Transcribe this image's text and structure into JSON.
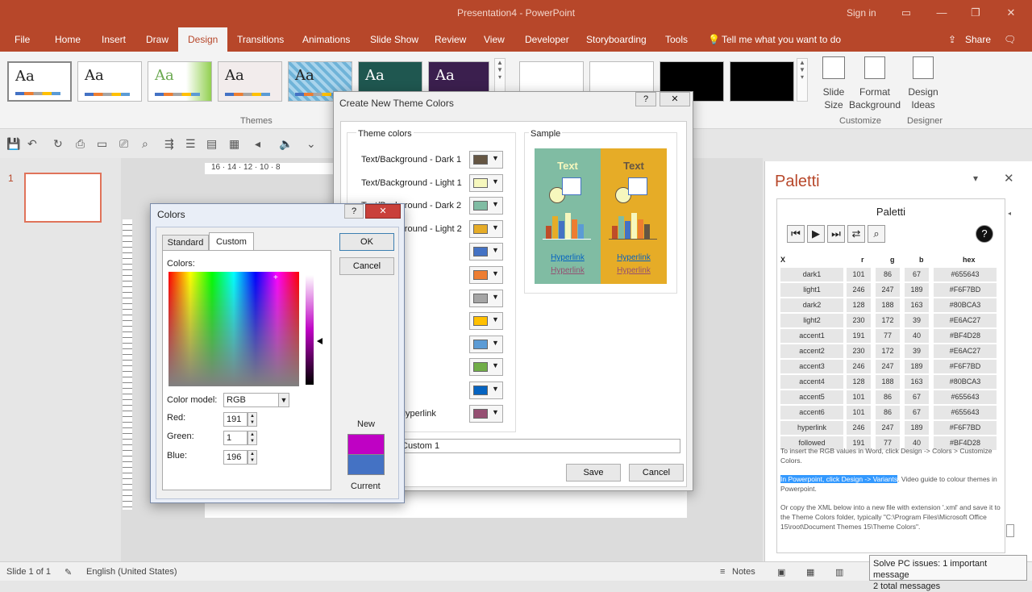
{
  "app": {
    "title": "Presentation4 - PowerPoint",
    "sign_in": "Sign in"
  },
  "tabs": [
    "File",
    "Home",
    "Insert",
    "Draw",
    "Design",
    "Transitions",
    "Animations",
    "Slide Show",
    "Review",
    "View",
    "Developer",
    "Storyboarding",
    "Tools"
  ],
  "tell_me": "Tell me what you want to do",
  "share": "Share",
  "ribbon": {
    "themes_label": "Themes",
    "customize_label": "Customize",
    "designer_label": "Designer",
    "theme_glyph": "Aa",
    "slide_size": "Slide\nSize",
    "format_background": "Format\nBackground",
    "design_ideas": "Design\nIdeas"
  },
  "ruler_text": "16 · 14 · 12 · 10 · 8",
  "slide_number": "1",
  "status": {
    "slide": "Slide 1 of 1",
    "language": "English (United States)",
    "notes": "Notes"
  },
  "notification": {
    "line1": "Solve PC issues: 1 important message",
    "line2": "2 total messages"
  },
  "paletti": {
    "pane_title": "Paletti",
    "header": "Paletti",
    "columns": [
      "X",
      "r",
      "g",
      "b",
      "hex"
    ],
    "rows": [
      {
        "name": "dark1",
        "r": "101",
        "g": "86",
        "b": "67",
        "hex": "#655643"
      },
      {
        "name": "light1",
        "r": "246",
        "g": "247",
        "b": "189",
        "hex": "#F6F7BD"
      },
      {
        "name": "dark2",
        "r": "128",
        "g": "188",
        "b": "163",
        "hex": "#80BCA3"
      },
      {
        "name": "light2",
        "r": "230",
        "g": "172",
        "b": "39",
        "hex": "#E6AC27"
      },
      {
        "name": "accent1",
        "r": "191",
        "g": "77",
        "b": "40",
        "hex": "#BF4D28"
      },
      {
        "name": "accent2",
        "r": "230",
        "g": "172",
        "b": "39",
        "hex": "#E6AC27"
      },
      {
        "name": "accent3",
        "r": "246",
        "g": "247",
        "b": "189",
        "hex": "#F6F7BD"
      },
      {
        "name": "accent4",
        "r": "128",
        "g": "188",
        "b": "163",
        "hex": "#80BCA3"
      },
      {
        "name": "accent5",
        "r": "101",
        "g": "86",
        "b": "67",
        "hex": "#655643"
      },
      {
        "name": "accent6",
        "r": "101",
        "g": "86",
        "b": "67",
        "hex": "#655643"
      },
      {
        "name": "hyperlink",
        "r": "246",
        "g": "247",
        "b": "189",
        "hex": "#F6F7BD"
      },
      {
        "name": "followed",
        "r": "191",
        "g": "77",
        "b": "40",
        "hex": "#BF4D28"
      }
    ],
    "text1": "To insert the RGB values in Word, click Design -> Colors > Customize Colors.",
    "text2_highlight": "In Powerpoint, click Design -> Variants",
    "text2_rest": ". Video guide to colour themes in Powerpoint.",
    "text3": "Or copy the XML below into a new file with extension '.xml' and save it to the Theme Colors folder, typically \"C:\\Program Files\\Microsoft Office 15\\root\\Document Themes 15\\Theme Colors\"."
  },
  "theme_dialog": {
    "title": "Create New Theme Colors",
    "help": "?",
    "group_theme": "Theme colors",
    "group_sample": "Sample",
    "rows": [
      "Text/Background - Dark 1",
      "Text/Background - Light 1",
      "Text/Background - Dark 2",
      "Text/Background - Light 2",
      "",
      "",
      "",
      "",
      "",
      "",
      "",
      "Followed Hyperlink"
    ],
    "swatches": [
      "#655643",
      "#F6F7BD",
      "#80BCA3",
      "#E6AC27",
      "#4472C4",
      "#ED7D31",
      "#A5A5A5",
      "#FFC000",
      "#5B9BD5",
      "#70AD47",
      "#0563C1",
      "#954F72"
    ],
    "sample_text": "Text",
    "sample_link": "Hyperlink",
    "name_value": "Custom 1",
    "save": "Save",
    "cancel": "Cancel"
  },
  "colors_dialog": {
    "title": "Colors",
    "help": "?",
    "tab_standard": "Standard",
    "tab_custom": "Custom",
    "colors_label": "Colors:",
    "color_model_label": "Color model:",
    "color_model": "RGB",
    "red_label": "Red:",
    "green_label": "Green:",
    "blue_label": "Blue:",
    "red": "191",
    "green": "1",
    "blue": "196",
    "ok": "OK",
    "cancel": "Cancel",
    "new_label": "New",
    "current_label": "Current",
    "new_color": "#BF01C4",
    "current_color": "#4472C4"
  }
}
